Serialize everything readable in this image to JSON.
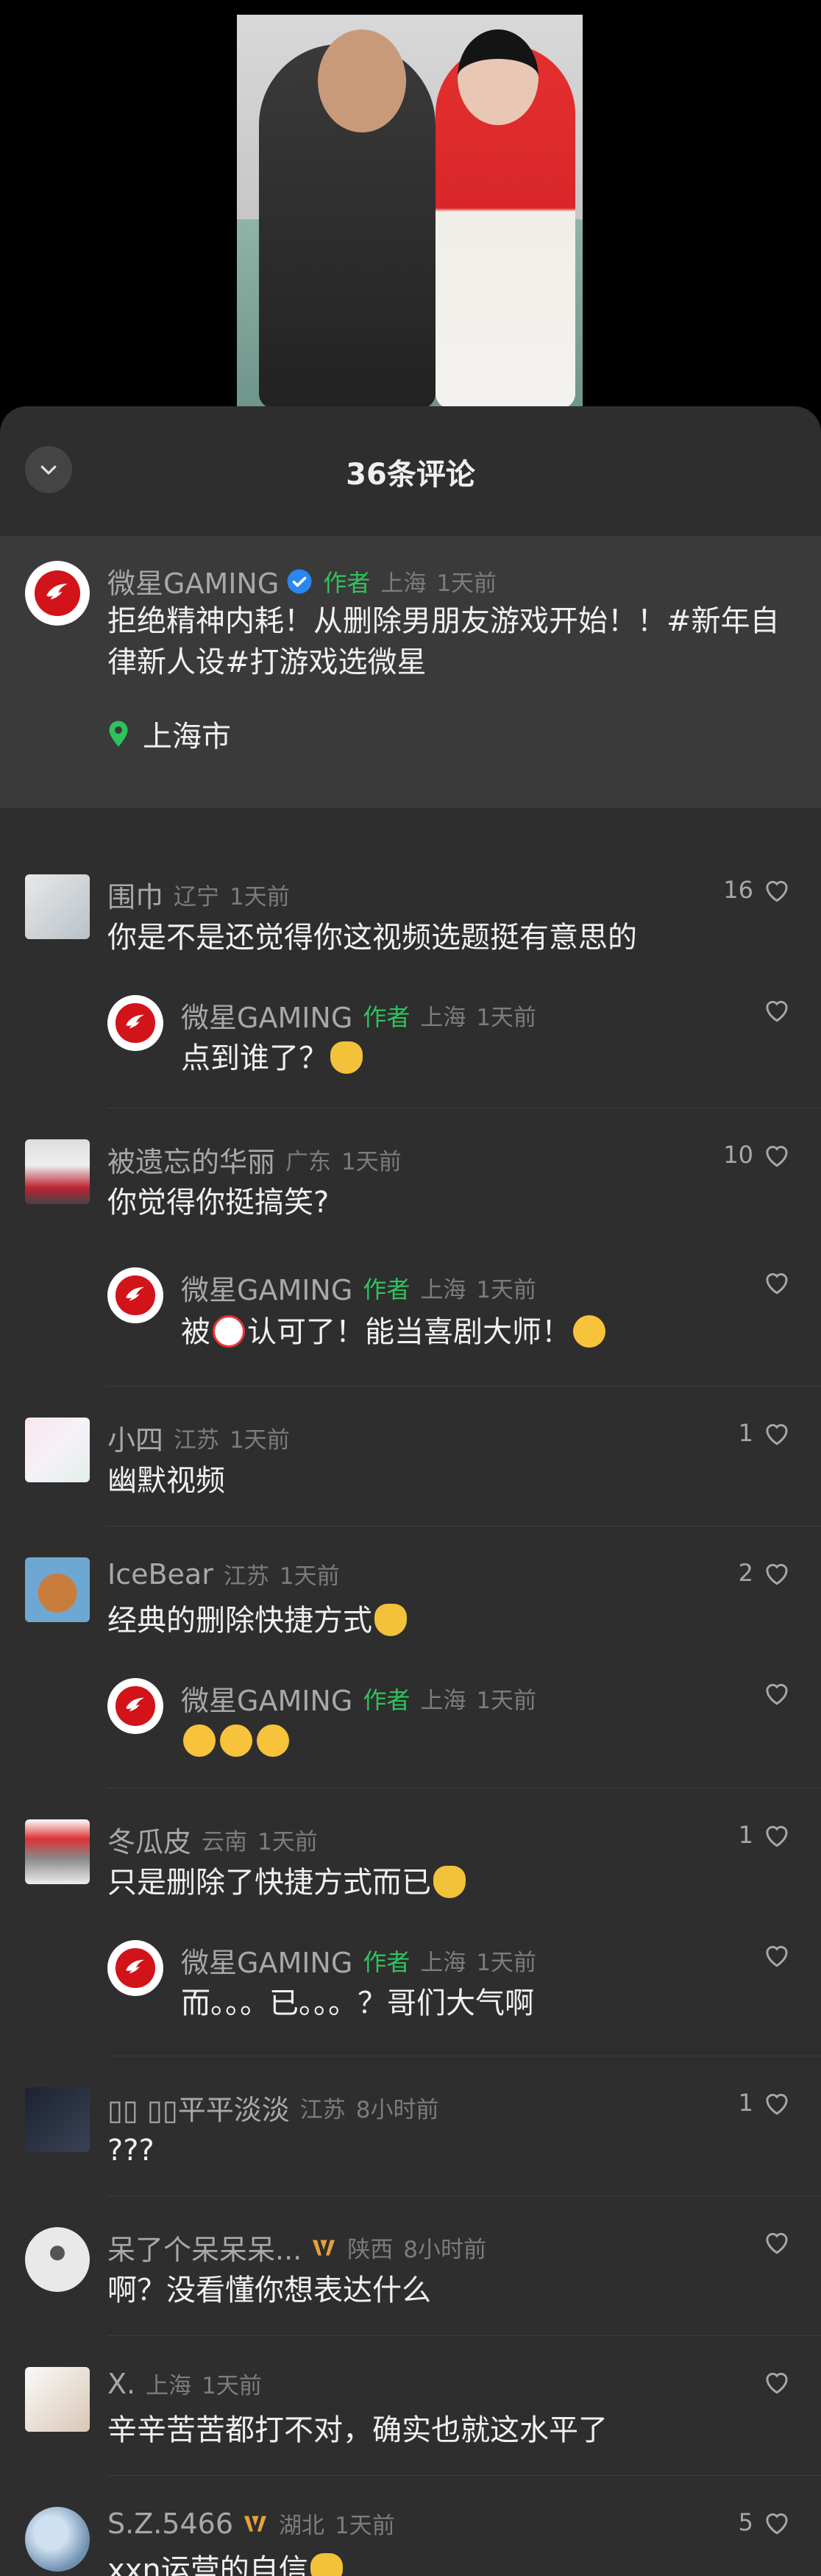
{
  "video": {
    "description_icon": "video-frame"
  },
  "panel": {
    "title": "36条评论"
  },
  "featured": {
    "name": "微星GAMING",
    "author_tag": "作者",
    "region": "上海",
    "time": "1天前",
    "text_line1": "拒绝精神内耗！从删除男朋友游戏开始！！#新年自",
    "text_line2": "律新人设#打游戏选微星",
    "location": "上海市"
  },
  "comments": [
    {
      "name": "围巾",
      "region": "辽宁",
      "time": "1天前",
      "text": "你是不是还觉得你这视频选题挺有意思的",
      "likes": "16",
      "reply": {
        "name": "微星GAMING",
        "author_tag": "作者",
        "region": "上海",
        "time": "1天前",
        "text": "点到谁了？"
      }
    },
    {
      "name": "被遗忘的华丽",
      "region": "广东",
      "time": "1天前",
      "text": "你觉得你挺搞笑?",
      "likes": "10",
      "reply": {
        "name": "微星GAMING",
        "author_tag": "作者",
        "region": "上海",
        "time": "1天前",
        "text_a": "被",
        "text_b": "认可了！能当喜剧大师！"
      }
    },
    {
      "name": "小四",
      "region": "江苏",
      "time": "1天前",
      "text": "幽默视频",
      "likes": "1"
    },
    {
      "name": "IceBear",
      "region": "江苏",
      "time": "1天前",
      "text": "经典的删除快捷方式",
      "likes": "2",
      "reply": {
        "name": "微星GAMING",
        "author_tag": "作者",
        "region": "上海",
        "time": "1天前"
      }
    },
    {
      "name": "冬瓜皮",
      "region": "云南",
      "time": "1天前",
      "text": "只是删除了快捷方式而已",
      "likes": "1",
      "reply": {
        "name": "微星GAMING",
        "author_tag": "作者",
        "region": "上海",
        "time": "1天前",
        "text": "而。。。已。。。？哥们大气啊"
      }
    },
    {
      "name": "▯▯ ▯▯平平淡淡",
      "region": "江苏",
      "time": "8小时前",
      "text": "???",
      "likes": "1"
    },
    {
      "name": "呆了个呆呆呆...",
      "region": "陕西",
      "time": "8小时前",
      "text": "啊？没看懂你想表达什么",
      "likes": ""
    },
    {
      "name": "X.",
      "region": "上海",
      "time": "1天前",
      "text": "辛辛苦苦都打不对，确实也就这水平了",
      "likes": ""
    },
    {
      "name": "S.Z.5466",
      "region": "湖北",
      "time": "1天前",
      "text": "xxn运营的自信",
      "likes": "5"
    }
  ],
  "colors": {
    "panel_bg": "#2e2e2e",
    "featured_bg": "#3a3a3a",
    "author_green": "#2fc35c",
    "msi_red": "#d3131a",
    "vip_gold": "#e6a23c"
  }
}
